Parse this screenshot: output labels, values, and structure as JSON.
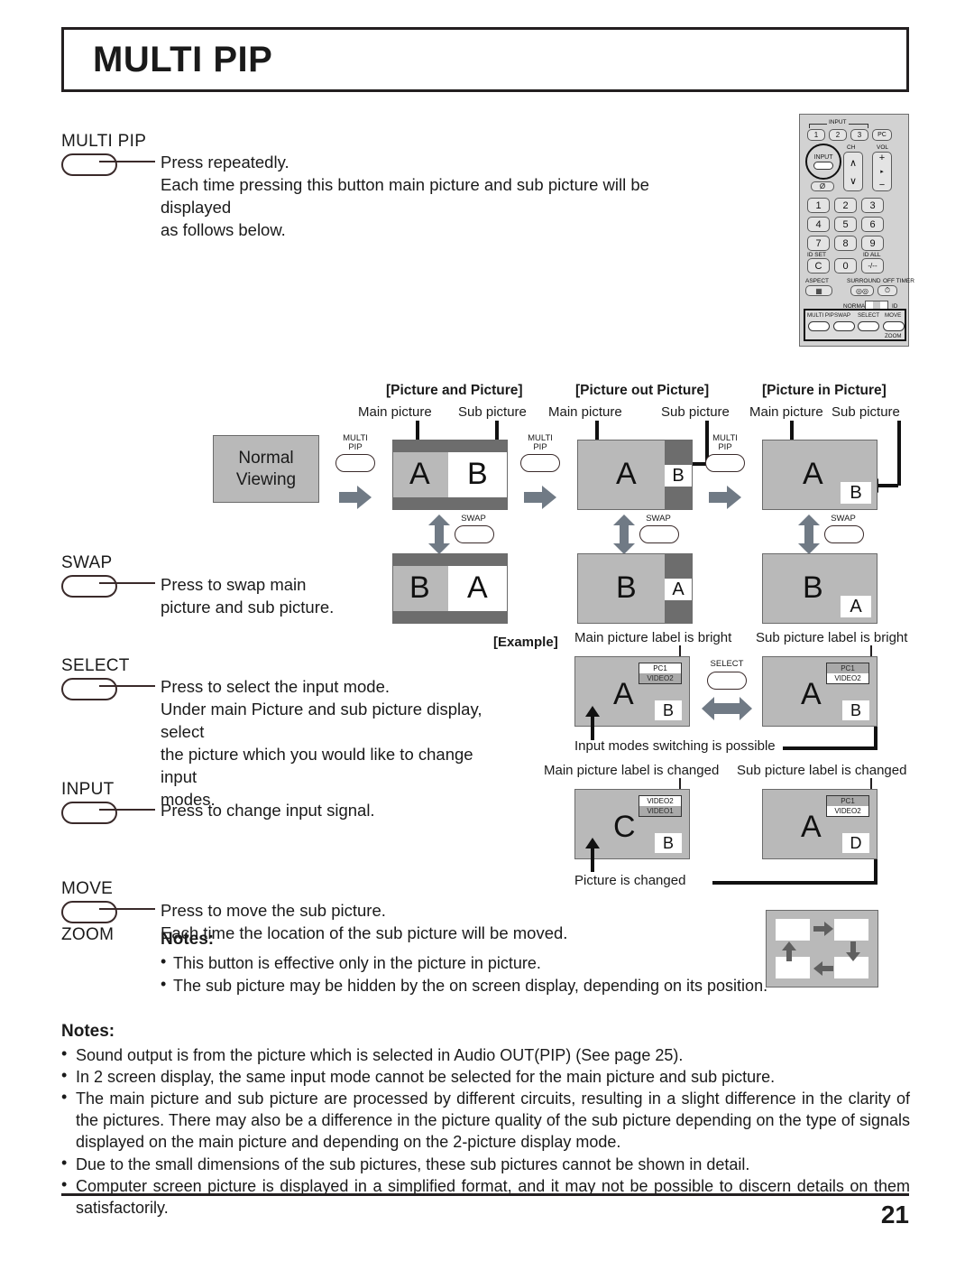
{
  "page": {
    "title": "MULTI PIP",
    "number": "21"
  },
  "buttons": [
    {
      "id": "multi-pip",
      "label": "MULTI PIP",
      "description": "Press repeatedly.\nEach time pressing this button main picture and sub picture will be displayed\nas follows below."
    },
    {
      "id": "swap",
      "label": "SWAP",
      "description": "Press  to  swap  main\npicture and sub picture."
    },
    {
      "id": "select",
      "label": "SELECT",
      "description": "Press to select the input mode.\nUnder main Picture and sub picture display, select\nthe picture which you would like to change input\nmodes."
    },
    {
      "id": "input",
      "label": "INPUT",
      "description": "Press to change input signal."
    },
    {
      "id": "move",
      "label": "MOVE",
      "sub_label": "ZOOM",
      "description": "Press to move the sub picture.\nEach time the location of the sub picture will be moved.",
      "notes_head": "Notes:",
      "notes": [
        "This button is effective only in the picture in picture.",
        "The sub picture may be hidden by the on screen display, depending on its position."
      ]
    }
  ],
  "remote": {
    "input_group_label": "INPUT",
    "input_keys": [
      "1",
      "2",
      "3",
      "PC"
    ],
    "input_dial": "INPUT",
    "mute_key": "Ø",
    "ch_label": "CH",
    "vol_label": "VOL",
    "ch_up": "∧",
    "ch_down": "∨",
    "vol_up": "+",
    "vol_down": "−",
    "numpad": [
      "1",
      "2",
      "3",
      "4",
      "5",
      "6",
      "7",
      "8",
      "9",
      "C",
      "0",
      "-/--"
    ],
    "id_set": "ID SET",
    "id_all": "ID ALL",
    "aspect": "ASPECT",
    "surround": "SURROUND",
    "off_timer": "OFF TIMER",
    "normal": "NORMAL",
    "id": "ID",
    "bottom_keys": [
      "MULTI PIP",
      "SWAP",
      "SELECT",
      "MOVE"
    ],
    "zoom_label": "ZOOM"
  },
  "flow": {
    "normal_viewing": "Normal\nViewing",
    "multi_pip_btn": "MULTI\nPIP",
    "swap_btn": "SWAP",
    "modes": [
      {
        "header": "[Picture and Picture]",
        "main_label": "Main picture",
        "sub_label": "Sub picture",
        "top_main": "A",
        "top_sub": "B",
        "bottom_main": "B",
        "bottom_sub": "A"
      },
      {
        "header": "[Picture out Picture]",
        "main_label": "Main picture",
        "sub_label": "Sub picture",
        "top_main": "A",
        "top_sub": "B",
        "bottom_main": "B",
        "bottom_sub": "A"
      },
      {
        "header": "[Picture in Picture]",
        "main_label": "Main picture",
        "sub_label": "Sub picture",
        "top_main": "A",
        "top_sub": "B",
        "bottom_main": "B",
        "bottom_sub": "A"
      }
    ]
  },
  "example": {
    "tag": "[Example]",
    "select_btn": "SELECT",
    "left_caption": "Main picture label is bright",
    "right_caption": "Sub picture label is bright",
    "left_screen": {
      "main": "A",
      "sub": "B",
      "osd_top": "PC1",
      "osd_bottom": "VIDEO2",
      "highlight": "top"
    },
    "right_screen": {
      "main": "A",
      "sub": "B",
      "osd_top": "PC1",
      "osd_bottom": "VIDEO2",
      "highlight": "bottom"
    },
    "switch_caption": "Input modes switching is possible",
    "changed_left_caption": "Main picture label is changed",
    "changed_right_caption": "Sub picture label is changed",
    "changed_left_screen": {
      "main": "C",
      "sub": "B",
      "osd_top": "VIDEO2",
      "osd_bottom": "VIDEO1",
      "highlight": "top"
    },
    "changed_right_screen": {
      "main": "A",
      "sub": "D",
      "osd_top": "PC1",
      "osd_bottom": "VIDEO2",
      "highlight": "bottom"
    },
    "picture_changed_caption": "Picture is changed"
  },
  "notes": {
    "heading": "Notes:",
    "items": [
      "Sound output is from the picture which is selected in Audio OUT(PIP) (See page 25).",
      "In 2 screen display, the same input mode cannot be selected for the main picture and sub picture.",
      "The main picture and sub picture are processed by different circuits, resulting in a slight difference in the clarity of the pictures. There may also be a difference in the picture quality of the sub picture depending on the type of signals displayed on the main picture and depending on the 2-picture display mode.",
      "Due to the small dimensions of the sub pictures, these sub pictures cannot be shown in detail.",
      "Computer screen picture is displayed in a simplified format, and it may not be possible to discern details on them satisfactorily."
    ]
  },
  "colors": {
    "screen_gray": "#b9b9b9",
    "dark_gray": "#6d6d6d",
    "arrow_gray": "#707a85",
    "ink": "#231f20"
  }
}
